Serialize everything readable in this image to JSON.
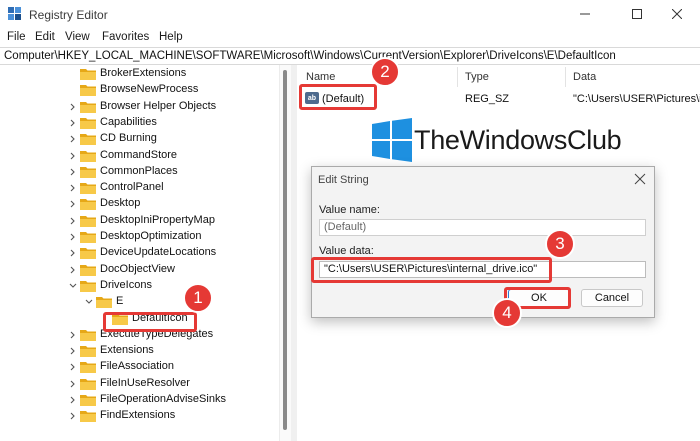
{
  "window": {
    "title": "Registry Editor",
    "controls": [
      "minimize-icon",
      "maximize-icon",
      "close-icon"
    ]
  },
  "menu": [
    "File",
    "Edit",
    "View",
    "Favorites",
    "Help"
  ],
  "address": "Computer\\HKEY_LOCAL_MACHINE\\SOFTWARE\\Microsoft\\Windows\\CurrentVersion\\Explorer\\DriveIcons\\E\\DefaultIcon",
  "tree": {
    "items": [
      {
        "label": "BrokerExtensions"
      },
      {
        "label": "BrowseNewProcess"
      },
      {
        "label": "Browser Helper Objects"
      },
      {
        "label": "Capabilities"
      },
      {
        "label": "CD Burning"
      },
      {
        "label": "CommandStore"
      },
      {
        "label": "CommonPlaces"
      },
      {
        "label": "ControlPanel"
      },
      {
        "label": "Desktop"
      },
      {
        "label": "DesktopIniPropertyMap"
      },
      {
        "label": "DesktopOptimization"
      },
      {
        "label": "DeviceUpdateLocations"
      },
      {
        "label": "DocObjectView"
      },
      {
        "label": "DriveIcons"
      },
      {
        "label": "E"
      },
      {
        "label": "DefaultIcon"
      },
      {
        "label": "ExecuteTypeDelegates"
      },
      {
        "label": "Extensions"
      },
      {
        "label": "FileAssociation"
      },
      {
        "label": "FileInUseResolver"
      },
      {
        "label": "FileOperationAdviseSinks"
      },
      {
        "label": "FindExtensions"
      }
    ]
  },
  "list": {
    "headers": {
      "name": "Name",
      "type": "Type",
      "data": "Data"
    },
    "rows": [
      {
        "icon": "ab",
        "name": "(Default)",
        "type": "REG_SZ",
        "data": "\"C:\\Users\\USER\\Pictures\\i"
      }
    ]
  },
  "watermark": "TheWindowsClub",
  "dialog": {
    "title": "Edit String",
    "value_name_label": "Value name:",
    "value_name": "(Default)",
    "value_data_label": "Value data:",
    "value_data": "\"C:\\Users\\USER\\Pictures\\internal_drive.ico\"",
    "ok": "OK",
    "cancel": "Cancel"
  },
  "badges": [
    "1",
    "2",
    "3",
    "4"
  ],
  "colors": {
    "highlight": "#e53935",
    "folder": "#f7c948",
    "logo": "#1e90e0"
  }
}
